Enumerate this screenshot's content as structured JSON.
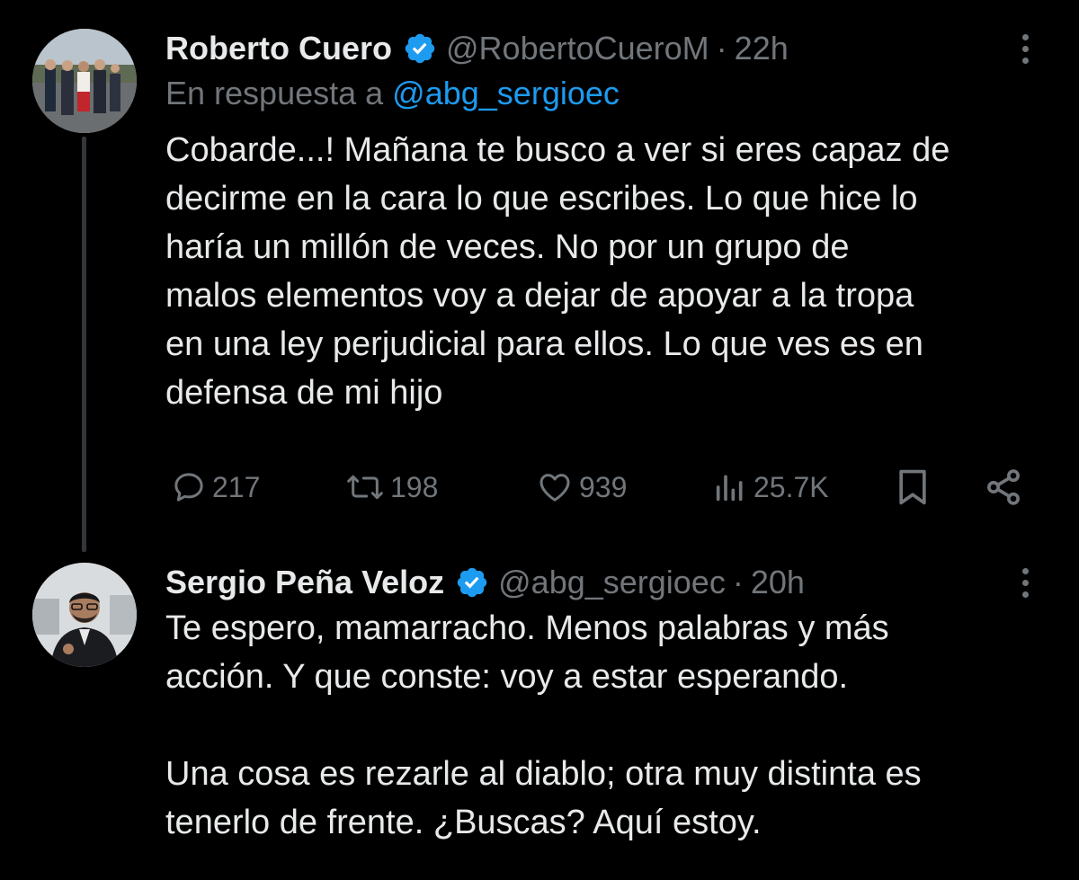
{
  "tweets": [
    {
      "author_name": "Roberto Cuero",
      "handle": "@RobertoCueroM",
      "separator": "·",
      "time": "22h",
      "reply_prefix": "En respuesta a",
      "reply_mention": "@abg_sergioec",
      "text": "Cobarde...! Mañana te busco a ver si eres capaz de\ndecirme en la cara lo que escribes. Lo que hice lo\nharía un millón de veces. No por un grupo de\nmalos elementos voy a dejar de apoyar a la tropa\nen una ley perjudicial para ellos. Lo que ves es en\ndefensa de mi hijo",
      "actions": {
        "replies": "217",
        "retweets": "198",
        "likes": "939",
        "views": "25.7K"
      }
    },
    {
      "author_name": "Sergio Peña Veloz",
      "handle": "@abg_sergioec",
      "separator": "·",
      "time": "20h",
      "text": "Te espero, mamarracho. Menos palabras y más\nacción. Y que conste: voy a estar esperando.\n\nUna cosa es rezarle al diablo; otra muy distinta es\ntenerlo de frente. ¿Buscas? Aquí estoy."
    }
  ],
  "colors": {
    "background": "#000000",
    "text": "#e7e9ea",
    "secondary": "#71767b",
    "accent": "#1d9bf0",
    "thread_line": "#333639"
  },
  "icons": [
    "verified-badge-icon",
    "more-icon",
    "reply-icon",
    "retweet-icon",
    "like-icon",
    "views-icon",
    "bookmark-icon",
    "share-icon"
  ]
}
